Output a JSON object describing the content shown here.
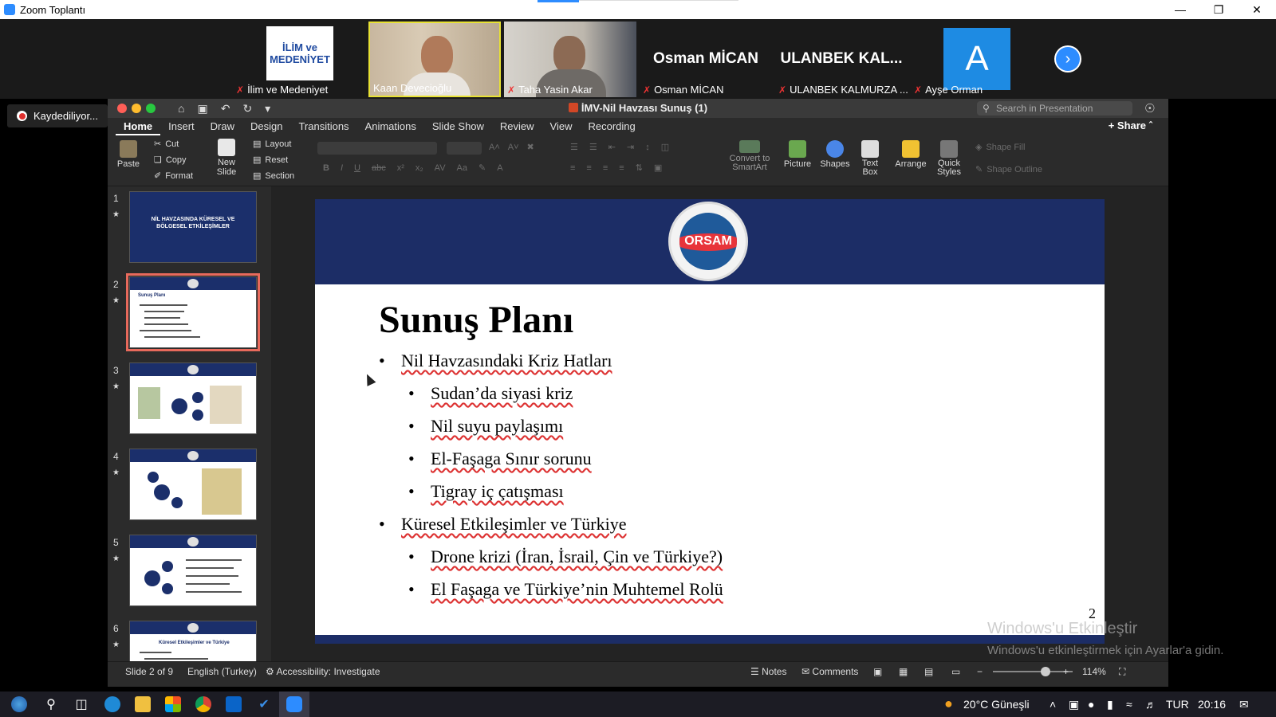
{
  "zoom": {
    "window_title": "Zoom Toplantı",
    "recording_label": "Kaydediliyor...",
    "participants": [
      {
        "name": "İlim ve Medeniyet",
        "logo_line1": "İLİM ve",
        "logo_line2": "MEDENİYET"
      },
      {
        "name": "Kaan Devecioğlu"
      },
      {
        "name": "Taha Yasin Akar"
      },
      {
        "name": "Osman MİCAN",
        "big_name": "Osman MİCAN"
      },
      {
        "name": "ULANBEK KALMURZA ...",
        "big_name": "ULANBEK KAL..."
      },
      {
        "name": "Ayşe Orman",
        "avatar_letter": "A"
      }
    ]
  },
  "ppt": {
    "title": "İMV-Nil Havzası Sunuş (1)",
    "search_placeholder": "Search in Presentation",
    "share_label": "Share",
    "tabs": [
      "Home",
      "Insert",
      "Draw",
      "Design",
      "Transitions",
      "Animations",
      "Slide Show",
      "Review",
      "View",
      "Recording"
    ],
    "ribbon": {
      "paste": "Paste",
      "cut": "Cut",
      "copy": "Copy",
      "format": "Format",
      "new_slide": "New Slide",
      "layout": "Layout",
      "reset": "Reset",
      "section": "Section",
      "convert": "Convert to SmartArt",
      "picture": "Picture",
      "shapes": "Shapes",
      "text_box": "Text Box",
      "arrange": "Arrange",
      "quick_styles": "Quick Styles",
      "shape_fill": "Shape Fill",
      "shape_outline": "Shape Outline"
    },
    "thumbnails": [
      {
        "num": "1",
        "title": "NİL HAVZASINDA KÜRESEL VE BÖLGESEL ETKİLEŞİMLER"
      },
      {
        "num": "2",
        "title": "Sunuş Planı"
      },
      {
        "num": "3"
      },
      {
        "num": "4"
      },
      {
        "num": "5"
      },
      {
        "num": "6",
        "title": "Küresel Etkileşimler ve Türkiye"
      }
    ],
    "slide": {
      "title": "Sunuş Planı",
      "logo_text": "ORSAM",
      "page_number": "2",
      "bullets": [
        {
          "level": 1,
          "text": "Nil Havzasındaki Kriz Hatları"
        },
        {
          "level": 2,
          "text": "Sudan’da siyasi kriz"
        },
        {
          "level": 2,
          "text": "Nil suyu paylaşımı"
        },
        {
          "level": 2,
          "text": "El-Faşaga Sınır sorunu"
        },
        {
          "level": 2,
          "text": "Tigray iç çatışması"
        },
        {
          "level": 1,
          "text": "Küresel Etkileşimler ve Türkiye"
        },
        {
          "level": 2,
          "text": "Drone krizi (İran, İsrail, Çin ve Türkiye?)"
        },
        {
          "level": 2,
          "text": "El Faşaga ve Türkiye’nin Muhtemel Rolü"
        }
      ]
    },
    "status": {
      "slide_info": "Slide 2 of 9",
      "language": "English (Turkey)",
      "accessibility": "Accessibility: Investigate",
      "notes": "Notes",
      "comments": "Comments",
      "zoom": "114%"
    }
  },
  "watermark": {
    "line1": "Windows'u Etkinleştir",
    "line2": "Windows'u etkinleştirmek için Ayarlar'a gidin."
  },
  "taskbar": {
    "weather": "20°C Güneşli",
    "language": "TUR",
    "time": "20:16"
  }
}
